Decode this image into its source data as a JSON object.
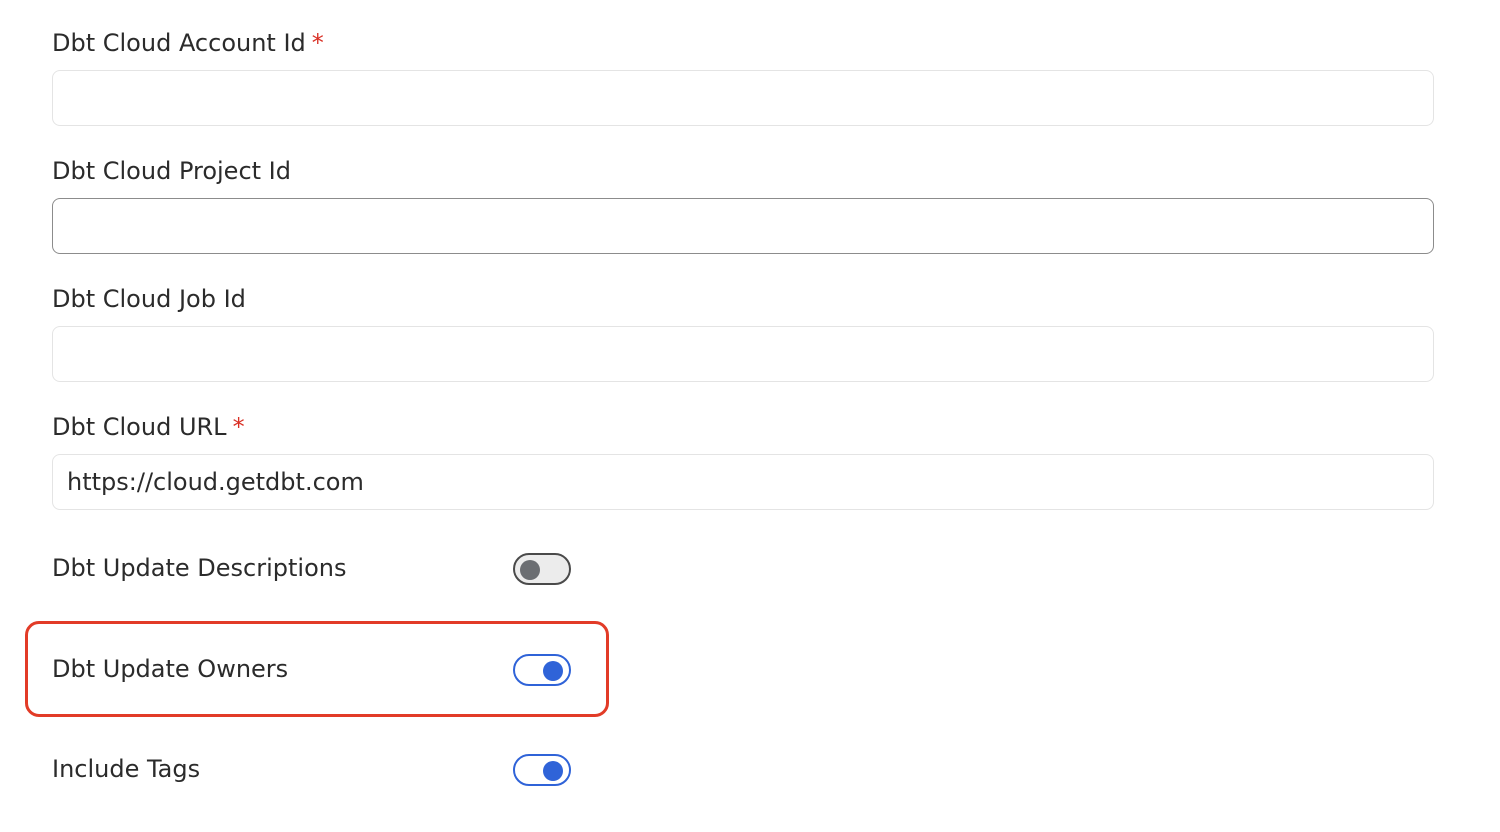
{
  "fields": [
    {
      "label": "Dbt Cloud Account Id",
      "required": true,
      "required_mark": "*",
      "value": "",
      "placeholder": ""
    },
    {
      "label": "Dbt Cloud Project Id",
      "required": false,
      "value": "",
      "placeholder": ""
    },
    {
      "label": "Dbt Cloud Job Id",
      "required": false,
      "value": "",
      "placeholder": ""
    },
    {
      "label": "Dbt Cloud URL",
      "required": true,
      "required_mark": "*",
      "value": "https://cloud.getdbt.com",
      "placeholder": ""
    }
  ],
  "toggles": [
    {
      "label": "Dbt Update Descriptions",
      "state": "off"
    },
    {
      "label": "Dbt Update Owners",
      "state": "on",
      "highlighted": true
    },
    {
      "label": "Include Tags",
      "state": "on"
    }
  ],
  "colors": {
    "accent": "#2f63d8",
    "required": "#d93025",
    "highlight": "#e23b27",
    "toggle_off_knob": "#6b6e72"
  }
}
